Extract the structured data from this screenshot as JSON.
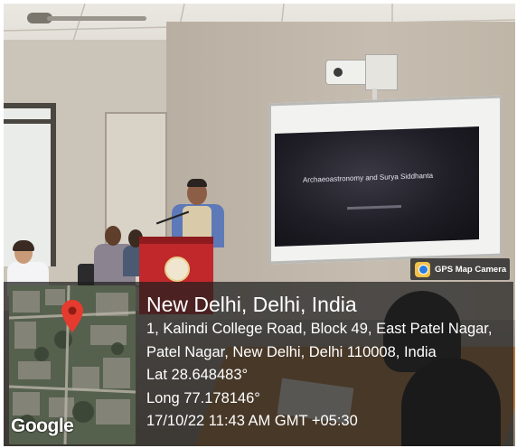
{
  "projected_slide": {
    "title": "Archaeoastronomy and Surya Siddhanta"
  },
  "watermark": {
    "app_name": "GPS Map Camera",
    "app_icon": "gps-map-camera-icon",
    "map_provider": "Google",
    "location": {
      "city": "New Delhi, Delhi, India",
      "address_line_1": "1, Kalindi College Road, Block 49, East Patel Nagar,",
      "address_line_2": "Patel Nagar, New Delhi, Delhi 110008, India",
      "latitude": "Lat 28.648483°",
      "longitude": "Long 77.178146°",
      "timestamp": "17/10/22 11:43 AM GMT +05:30"
    },
    "pin_color": "#e53b2f"
  }
}
